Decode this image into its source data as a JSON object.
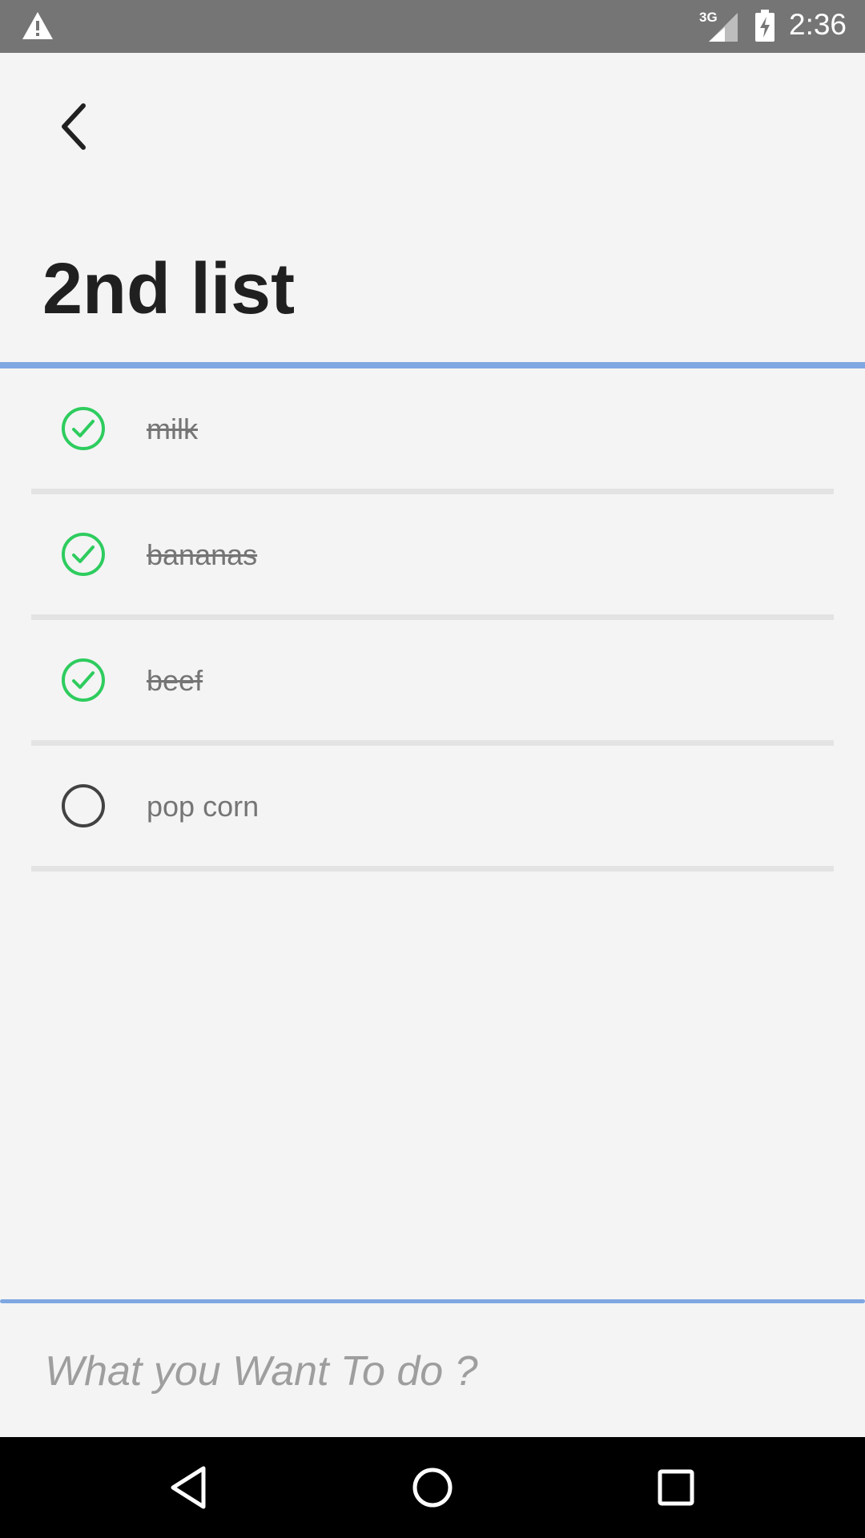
{
  "status_bar": {
    "network_label": "3G",
    "time": "2:36",
    "icons": [
      "warning-icon",
      "signal-icon",
      "battery-charging-icon"
    ]
  },
  "header": {
    "back_icon": "chevron-left-icon",
    "title": "2nd list"
  },
  "todos": [
    {
      "label": "milk",
      "done": true
    },
    {
      "label": "bananas",
      "done": true
    },
    {
      "label": "beef",
      "done": true
    },
    {
      "label": "pop corn",
      "done": false
    }
  ],
  "input": {
    "placeholder": "What you Want To do ?",
    "value": ""
  },
  "nav_bar": {
    "icons": [
      "back-triangle-icon",
      "home-circle-icon",
      "recents-square-icon"
    ]
  },
  "colors": {
    "accent": "#7fa7e2",
    "check_done": "#2ecc5e",
    "check_open": "#424242",
    "status_bar": "#757575",
    "background": "#f4f4f4"
  }
}
